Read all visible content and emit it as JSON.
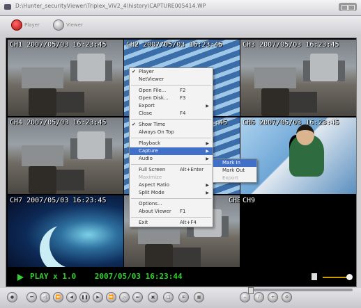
{
  "window": {
    "title": "D:\\Hunter_securityViewer\\Triplex_ViV2_4\\history\\CAPTURE005414.WP"
  },
  "modes": [
    {
      "label": "Player",
      "icon": "player-icon"
    },
    {
      "label": "Viewer",
      "icon": "viewer-icon"
    }
  ],
  "tiles": [
    {
      "stamp": "CH1 2007/05/03 16:23:45",
      "scene": "office"
    },
    {
      "stamp": "CH2 2007/05/03 16:23:45",
      "scene": "stairs"
    },
    {
      "stamp": "CH3 2007/05/03 16:23:45",
      "scene": "office"
    },
    {
      "stamp": "CH4 2007/05/03 16:23:45",
      "scene": "office"
    },
    {
      "stamp": "…:45",
      "scene": "stairs"
    },
    {
      "stamp": "CH6 2007/05/03 16:23:45",
      "scene": "cartoon"
    },
    {
      "stamp": "CH7 2007/05/03 16:23:45",
      "scene": "night"
    },
    {
      "stamp": "CH8",
      "scene": "office"
    },
    {
      "stamp": "CH9",
      "scene": "black"
    }
  ],
  "status": {
    "mode": "PLAY",
    "speed": "x 1.0",
    "datetime": "2007/05/03 16:23:44",
    "color": "#2fd32f"
  },
  "context_menu": {
    "items": [
      {
        "label": "Player",
        "checked": true
      },
      {
        "label": "NetViewer"
      },
      {
        "separator": true
      },
      {
        "label": "Open File...",
        "shortcut": "F2"
      },
      {
        "label": "Open Disk...",
        "shortcut": "F3"
      },
      {
        "label": "Export",
        "submenu": true
      },
      {
        "label": "Close",
        "shortcut": "F4"
      },
      {
        "separator": true
      },
      {
        "label": "Show Time",
        "checked": true
      },
      {
        "label": "Always On Top"
      },
      {
        "separator": true
      },
      {
        "label": "Playback",
        "submenu": true
      },
      {
        "label": "Capture",
        "submenu": true,
        "highlighted": true
      },
      {
        "label": "Audio",
        "submenu": true
      },
      {
        "separator": true
      },
      {
        "label": "Full Screen",
        "shortcut": "Alt+Enter"
      },
      {
        "label": "Maximize",
        "disabled": true
      },
      {
        "label": "Aspect Ratio",
        "submenu": true
      },
      {
        "label": "Split Mode",
        "submenu": true
      },
      {
        "separator": true
      },
      {
        "label": "Options..."
      },
      {
        "label": "About Viewer",
        "shortcut": "F1"
      },
      {
        "separator": true
      },
      {
        "label": "Exit",
        "shortcut": "Alt+F4"
      }
    ]
  },
  "capture_submenu": {
    "items": [
      {
        "label": "Mark In",
        "highlighted": true
      },
      {
        "label": "Mark Out"
      },
      {
        "label": "Export",
        "disabled": true
      }
    ]
  },
  "toolbar": {
    "buttons": [
      "record-icon",
      "skip-back-icon",
      "step-back-icon",
      "rewind-icon",
      "reverse-play-icon",
      "pause-icon",
      "play-icon",
      "fast-forward-icon",
      "step-forward-icon",
      "skip-forward-icon",
      "camera-icon",
      "single-view-icon",
      "quad-view-icon",
      "nine-view-icon",
      "zoom-out-icon",
      "audio-icon",
      "zoom-in-icon",
      "settings-icon"
    ]
  },
  "colors": {
    "accent_highlight": "#4170c8",
    "status_green": "#2fd32f",
    "mode_red": "#cc2020"
  }
}
